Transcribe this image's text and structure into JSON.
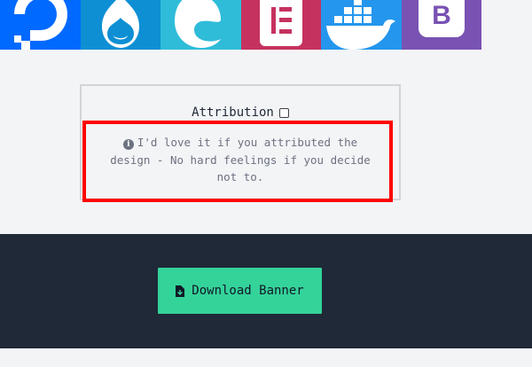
{
  "icons": [
    {
      "name": "digitalocean-icon",
      "bg": "#0069ff"
    },
    {
      "name": "drupal-icon",
      "bg": "#0e8fd4"
    },
    {
      "name": "edge-icon",
      "bg": "#2fbcd9"
    },
    {
      "name": "elementor-icon",
      "bg": "#c6325f"
    },
    {
      "name": "docker-icon",
      "bg": "#2496ed"
    },
    {
      "name": "bootstrap-icon",
      "bg": "#7952b3"
    }
  ],
  "attribution": {
    "label": "Attribution",
    "checked": false,
    "note": "I'd love it if you attributed the design - No hard feelings if you decide not to."
  },
  "download": {
    "label": "Download Banner"
  },
  "colors": {
    "background": "#f3f4f6",
    "dark_band": "#1f2937",
    "button": "#34d399",
    "highlight": "#ff0000"
  }
}
